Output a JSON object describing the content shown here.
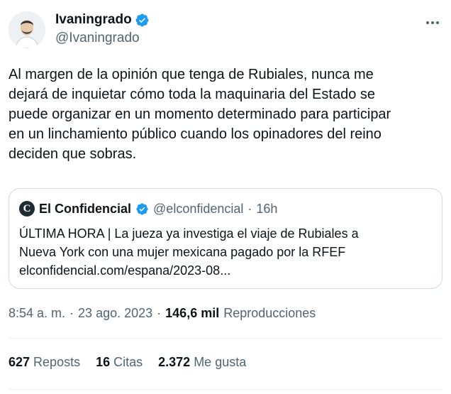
{
  "author": {
    "display_name": "Ivaningrado",
    "handle": "@Ivaningrado",
    "verified": true,
    "avatar_icon": "avatar-illustration"
  },
  "tweet": {
    "text": "Al margen de la opinión que tenga de Rubiales, nunca me\ndejará de inquietar cómo toda la maquinaria del Estado se\npuede organizar en un momento determinado para participar\nen un linchamiento público cuando los opinadores del reino\ndeciden que sobras."
  },
  "quote": {
    "logo_letter": "C",
    "name": "El Confidencial",
    "handle": "@elconfidencial",
    "separator": "·",
    "time": "16h",
    "text": "ÚLTIMA HORA | La jueza ya investiga el viaje de Rubiales a\nNueva York con una mujer mexicana pagado por la RFEF\nelconfidencial.com/espana/2023-08..."
  },
  "meta": {
    "time": "8:54 a. m.",
    "sep1": "·",
    "date": "23 ago. 2023",
    "sep2": "·",
    "views_count": "146,6 mil",
    "views_label": "Reproducciones"
  },
  "stats": {
    "reposts_count": "627",
    "reposts_label": "Reposts",
    "quotes_count": "16",
    "quotes_label": "Citas",
    "likes_count": "2.372",
    "likes_label": "Me gusta"
  },
  "colors": {
    "verified": "#1d9bf0",
    "secondary_text": "#536471",
    "border": "#cfd9de"
  }
}
